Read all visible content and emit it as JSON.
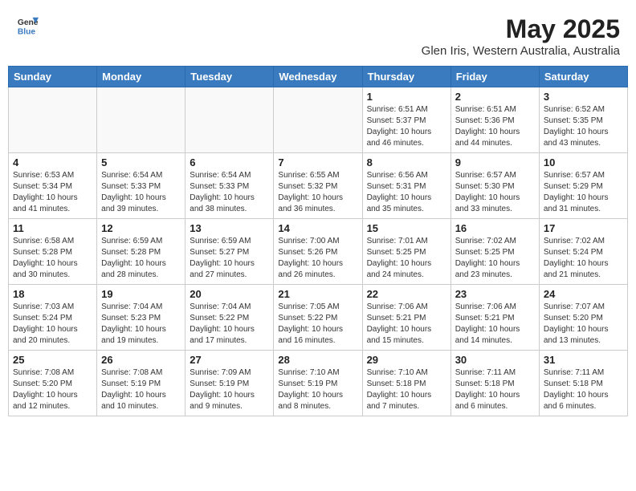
{
  "header": {
    "logo_line1": "General",
    "logo_line2": "Blue",
    "title": "May 2025",
    "subtitle": "Glen Iris, Western Australia, Australia"
  },
  "days_of_week": [
    "Sunday",
    "Monday",
    "Tuesday",
    "Wednesday",
    "Thursday",
    "Friday",
    "Saturday"
  ],
  "weeks": [
    [
      {
        "day": "",
        "info": ""
      },
      {
        "day": "",
        "info": ""
      },
      {
        "day": "",
        "info": ""
      },
      {
        "day": "",
        "info": ""
      },
      {
        "day": "1",
        "info": "Sunrise: 6:51 AM\nSunset: 5:37 PM\nDaylight: 10 hours\nand 46 minutes."
      },
      {
        "day": "2",
        "info": "Sunrise: 6:51 AM\nSunset: 5:36 PM\nDaylight: 10 hours\nand 44 minutes."
      },
      {
        "day": "3",
        "info": "Sunrise: 6:52 AM\nSunset: 5:35 PM\nDaylight: 10 hours\nand 43 minutes."
      }
    ],
    [
      {
        "day": "4",
        "info": "Sunrise: 6:53 AM\nSunset: 5:34 PM\nDaylight: 10 hours\nand 41 minutes."
      },
      {
        "day": "5",
        "info": "Sunrise: 6:54 AM\nSunset: 5:33 PM\nDaylight: 10 hours\nand 39 minutes."
      },
      {
        "day": "6",
        "info": "Sunrise: 6:54 AM\nSunset: 5:33 PM\nDaylight: 10 hours\nand 38 minutes."
      },
      {
        "day": "7",
        "info": "Sunrise: 6:55 AM\nSunset: 5:32 PM\nDaylight: 10 hours\nand 36 minutes."
      },
      {
        "day": "8",
        "info": "Sunrise: 6:56 AM\nSunset: 5:31 PM\nDaylight: 10 hours\nand 35 minutes."
      },
      {
        "day": "9",
        "info": "Sunrise: 6:57 AM\nSunset: 5:30 PM\nDaylight: 10 hours\nand 33 minutes."
      },
      {
        "day": "10",
        "info": "Sunrise: 6:57 AM\nSunset: 5:29 PM\nDaylight: 10 hours\nand 31 minutes."
      }
    ],
    [
      {
        "day": "11",
        "info": "Sunrise: 6:58 AM\nSunset: 5:28 PM\nDaylight: 10 hours\nand 30 minutes."
      },
      {
        "day": "12",
        "info": "Sunrise: 6:59 AM\nSunset: 5:28 PM\nDaylight: 10 hours\nand 28 minutes."
      },
      {
        "day": "13",
        "info": "Sunrise: 6:59 AM\nSunset: 5:27 PM\nDaylight: 10 hours\nand 27 minutes."
      },
      {
        "day": "14",
        "info": "Sunrise: 7:00 AM\nSunset: 5:26 PM\nDaylight: 10 hours\nand 26 minutes."
      },
      {
        "day": "15",
        "info": "Sunrise: 7:01 AM\nSunset: 5:25 PM\nDaylight: 10 hours\nand 24 minutes."
      },
      {
        "day": "16",
        "info": "Sunrise: 7:02 AM\nSunset: 5:25 PM\nDaylight: 10 hours\nand 23 minutes."
      },
      {
        "day": "17",
        "info": "Sunrise: 7:02 AM\nSunset: 5:24 PM\nDaylight: 10 hours\nand 21 minutes."
      }
    ],
    [
      {
        "day": "18",
        "info": "Sunrise: 7:03 AM\nSunset: 5:24 PM\nDaylight: 10 hours\nand 20 minutes."
      },
      {
        "day": "19",
        "info": "Sunrise: 7:04 AM\nSunset: 5:23 PM\nDaylight: 10 hours\nand 19 minutes."
      },
      {
        "day": "20",
        "info": "Sunrise: 7:04 AM\nSunset: 5:22 PM\nDaylight: 10 hours\nand 17 minutes."
      },
      {
        "day": "21",
        "info": "Sunrise: 7:05 AM\nSunset: 5:22 PM\nDaylight: 10 hours\nand 16 minutes."
      },
      {
        "day": "22",
        "info": "Sunrise: 7:06 AM\nSunset: 5:21 PM\nDaylight: 10 hours\nand 15 minutes."
      },
      {
        "day": "23",
        "info": "Sunrise: 7:06 AM\nSunset: 5:21 PM\nDaylight: 10 hours\nand 14 minutes."
      },
      {
        "day": "24",
        "info": "Sunrise: 7:07 AM\nSunset: 5:20 PM\nDaylight: 10 hours\nand 13 minutes."
      }
    ],
    [
      {
        "day": "25",
        "info": "Sunrise: 7:08 AM\nSunset: 5:20 PM\nDaylight: 10 hours\nand 12 minutes."
      },
      {
        "day": "26",
        "info": "Sunrise: 7:08 AM\nSunset: 5:19 PM\nDaylight: 10 hours\nand 10 minutes."
      },
      {
        "day": "27",
        "info": "Sunrise: 7:09 AM\nSunset: 5:19 PM\nDaylight: 10 hours\nand 9 minutes."
      },
      {
        "day": "28",
        "info": "Sunrise: 7:10 AM\nSunset: 5:19 PM\nDaylight: 10 hours\nand 8 minutes."
      },
      {
        "day": "29",
        "info": "Sunrise: 7:10 AM\nSunset: 5:18 PM\nDaylight: 10 hours\nand 7 minutes."
      },
      {
        "day": "30",
        "info": "Sunrise: 7:11 AM\nSunset: 5:18 PM\nDaylight: 10 hours\nand 6 minutes."
      },
      {
        "day": "31",
        "info": "Sunrise: 7:11 AM\nSunset: 5:18 PM\nDaylight: 10 hours\nand 6 minutes."
      }
    ]
  ]
}
